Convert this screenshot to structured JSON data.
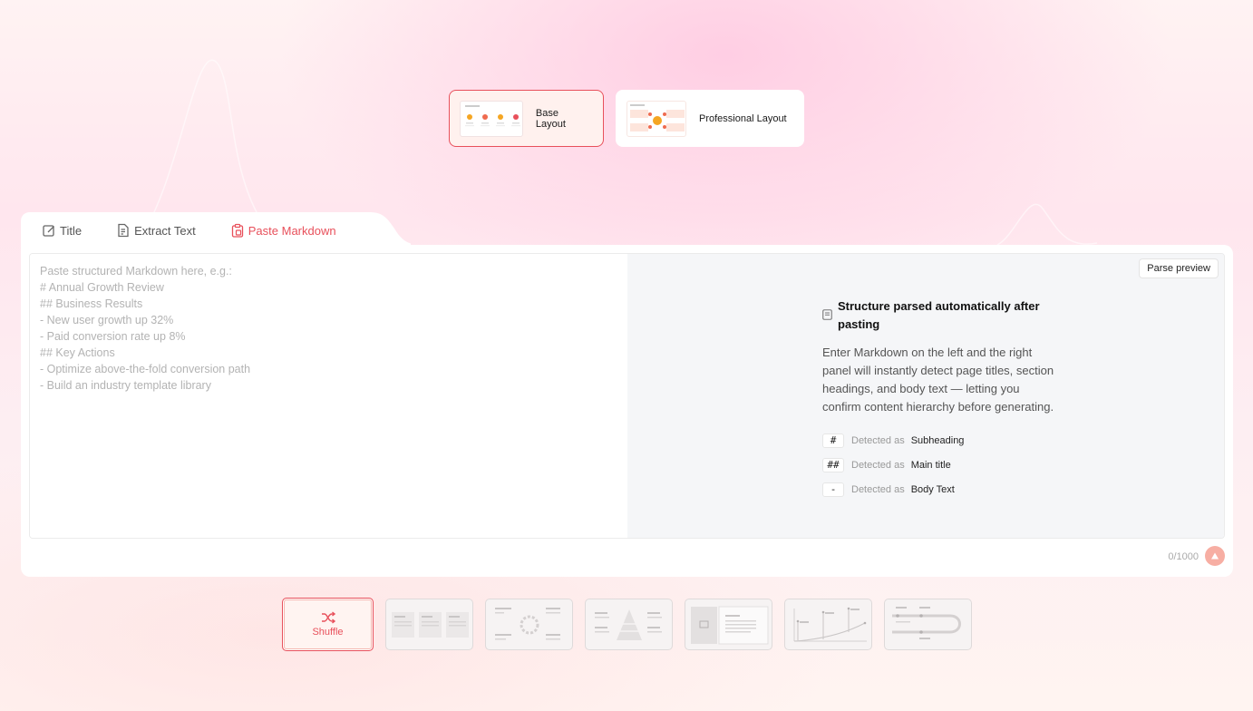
{
  "layouts": [
    {
      "label": "Base Layout",
      "active": true
    },
    {
      "label": "Professional Layout",
      "active": false
    }
  ],
  "tabs": [
    {
      "label": "Title",
      "icon": "edit-icon"
    },
    {
      "label": "Extract Text",
      "icon": "file-text-icon"
    },
    {
      "label": "Paste Markdown",
      "icon": "clipboard-icon",
      "active": true
    }
  ],
  "editor": {
    "placeholder": "Paste structured Markdown here, e.g.:\n# Annual Growth Review\n## Business Results\n- New user growth up 32%\n- Paid conversion rate up 8%\n## Key Actions\n- Optimize above-the-fold conversion path\n- Build an industry template library"
  },
  "preview": {
    "parse_button": "Parse preview",
    "hint_title": "Structure parsed automatically after pasting",
    "hint_body": "Enter Markdown on the left and the right panel will instantly detect page titles, section headings, and body text — letting you confirm content hierarchy before generating.",
    "legend": [
      {
        "symbol": "#",
        "detected": "Detected as",
        "value": "Subheading"
      },
      {
        "symbol": "##",
        "detected": "Detected as",
        "value": "Main title"
      },
      {
        "symbol": "-",
        "detected": "Detected as",
        "value": "Body Text"
      }
    ]
  },
  "counter": "0/1000",
  "strip": {
    "shuffle_label": "Shuffle"
  },
  "colors": {
    "accent": "#e8505b",
    "send": "#f7aea3"
  }
}
